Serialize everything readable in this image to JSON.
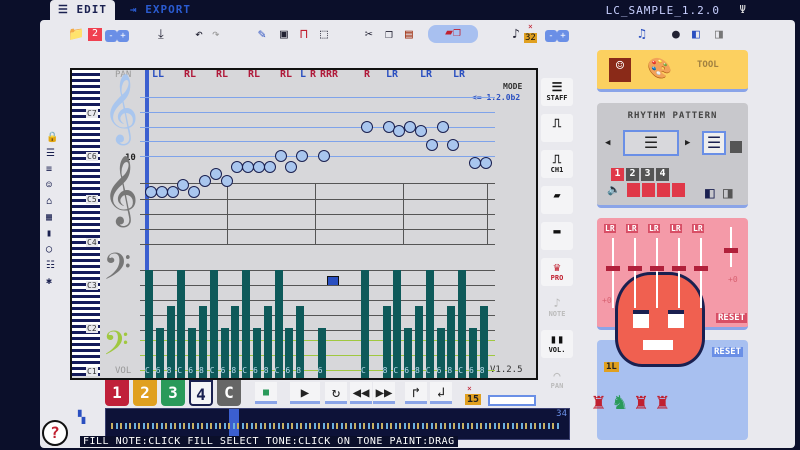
{
  "tabs": [
    {
      "label": "EDIT",
      "active": true
    },
    {
      "label": "EXPORT",
      "active": false
    }
  ],
  "file_title": "LC_SAMPLE_1.2.0",
  "toolbar": {
    "track_count": "2",
    "minus": "-",
    "plus": "+",
    "note_length": "32",
    "multiplier": "×"
  },
  "editor": {
    "pan_label": "PAN",
    "vol_label": "VOL",
    "mode_label": "MODE",
    "mode_value": "<= 1.2.0b2",
    "measure_number": "10",
    "version": "V1.2.5",
    "octaves": [
      "C7",
      "C6",
      "C5",
      "C4",
      "C3",
      "C2",
      "C1"
    ],
    "pan_marks": [
      "LL",
      "RL",
      "RL",
      "RL",
      "RL",
      "L",
      "R",
      "RRR",
      "R",
      "LR",
      "LR",
      "LR"
    ],
    "notes": [
      [
        0,
        74
      ],
      [
        1,
        74
      ],
      [
        2,
        74
      ],
      [
        3,
        76
      ],
      [
        4,
        74
      ],
      [
        5,
        77
      ],
      [
        6,
        79
      ],
      [
        7,
        77
      ],
      [
        8,
        81
      ],
      [
        9,
        81
      ],
      [
        10,
        81
      ],
      [
        11,
        81
      ],
      [
        12,
        84
      ],
      [
        13,
        81
      ],
      [
        14,
        84
      ],
      [
        16,
        84
      ],
      [
        20,
        92
      ],
      [
        22,
        92
      ],
      [
        23,
        91
      ],
      [
        24,
        92
      ],
      [
        25,
        91
      ],
      [
        26,
        87
      ],
      [
        27,
        92
      ],
      [
        28,
        87
      ],
      [
        30,
        82
      ],
      [
        31,
        82
      ]
    ],
    "volumes": [
      15,
      7,
      10,
      15,
      7,
      10,
      15,
      7,
      10,
      15,
      7,
      10,
      15,
      7,
      10,
      0,
      7,
      0,
      0,
      0,
      15,
      0,
      10,
      15,
      7,
      10,
      15,
      7,
      10,
      15,
      7,
      10
    ],
    "step_labels": [
      "C",
      "6",
      "8",
      "C",
      "6",
      "8",
      "C",
      "6",
      "8",
      "C",
      "6",
      "8",
      "C",
      "6",
      "8",
      "",
      "6",
      "",
      "",
      "",
      "C",
      "",
      "8",
      "C",
      "6",
      "8",
      "C",
      "6",
      "8",
      "C",
      "6",
      "8"
    ],
    "volume_max": 15,
    "colors": {
      "bar": "#0e5a5a",
      "note": "#a9c6ee",
      "staff": "#7fa3ea",
      "pan_l": "#2a4fc0",
      "pan_r": "#b01a3a"
    }
  },
  "tools": [
    {
      "label": "STAFF"
    },
    {
      "label": ""
    },
    {
      "label": "CH1"
    },
    {
      "label": ""
    },
    {
      "label": ""
    },
    {
      "label": "PRO"
    },
    {
      "label": "NOTE"
    },
    {
      "label": "VOL."
    },
    {
      "label": "PAN"
    }
  ],
  "tracks": [
    {
      "label": "1",
      "color": "#c0203a"
    },
    {
      "label": "2",
      "color": "#e0a020"
    },
    {
      "label": "3",
      "color": "#2a9a5a"
    },
    {
      "label": "4",
      "color": "#f4f4f6"
    },
    {
      "label": "C",
      "color": "#666"
    }
  ],
  "transport": {
    "speed": "15",
    "mult": "×",
    "minimap_count": "34"
  },
  "status": "FILL NOTE:CLICK   FILL SELECT TONE:CLICK ON TONE   PAINT:DRAG",
  "right_panel": {
    "tool_label": "TOOL",
    "rhythm_title": "RHYTHM PATTERN",
    "patterns": [
      "1",
      "2",
      "3",
      "4"
    ],
    "lr_labels": [
      "LR",
      "LR",
      "LR",
      "LR",
      "LR"
    ],
    "pan_value": "+0",
    "vol_value": "+0",
    "reset1": "RESET",
    "reset2": "RESET",
    "speed_label": "1L"
  }
}
